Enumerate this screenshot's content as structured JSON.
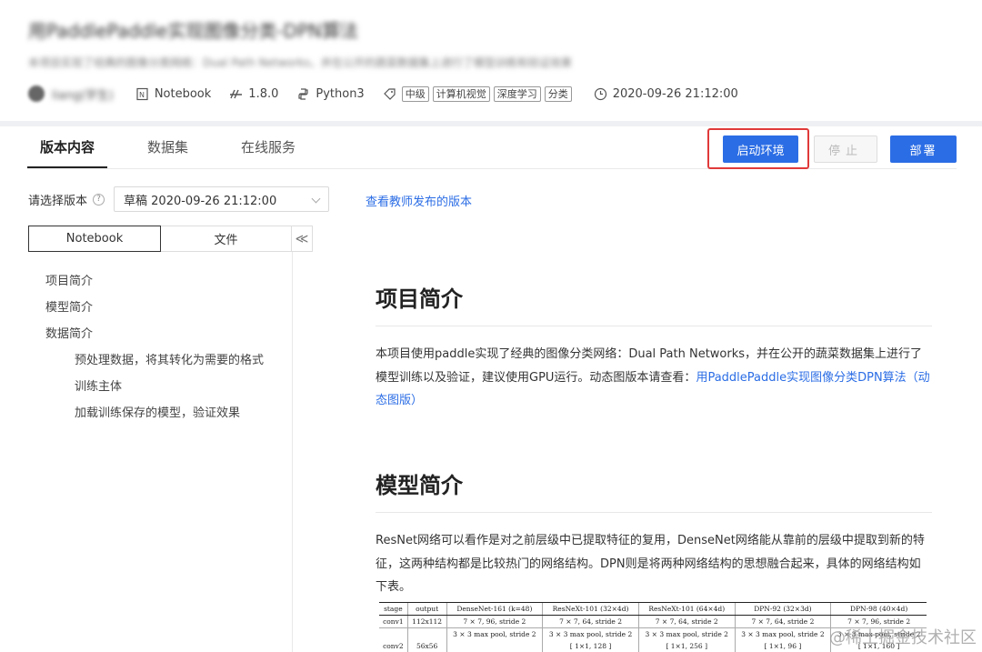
{
  "project": {
    "title": "用PaddlePaddle实现图像分类-DPN算法",
    "description": "本项目实现了经典的图像分类网络：Dual Path Networks，并在公开的蔬菜数据集上进行了模型训练和验证效果",
    "author": "liang(学生)",
    "notebook_label": "Notebook",
    "version": "1.8.0",
    "language": "Python3",
    "tags": [
      "中级",
      "计算机视觉",
      "深度学习",
      "分类"
    ],
    "datetime": "2020-09-26 21:12:00"
  },
  "tabs": [
    {
      "label": "版本内容",
      "active": true
    },
    {
      "label": "数据集",
      "active": false
    },
    {
      "label": "在线服务",
      "active": false
    }
  ],
  "actions": {
    "start_label": "启动环境",
    "stop_label": "停止",
    "deploy_label": "部署"
  },
  "version_select": {
    "label": "请选择版本",
    "help_glyph": "?",
    "value": "草稿 2020-09-26 21:12:00",
    "teacher_link": "查看教师发布的版本"
  },
  "left_panel": {
    "tab_notebook": "Notebook",
    "tab_files": "文件",
    "collapse_glyph": "≪",
    "toc": [
      {
        "label": "项目简介",
        "level": 1
      },
      {
        "label": "模型简介",
        "level": 1
      },
      {
        "label": "数据简介",
        "level": 1
      },
      {
        "label": "预处理数据，将其转化为需要的格式",
        "level": 2
      },
      {
        "label": "训练主体",
        "level": 2
      },
      {
        "label": "加载训练保存的模型，验证效果",
        "level": 2
      }
    ]
  },
  "notebook": {
    "section1_title": "项目简介",
    "section1_text": "本项目使用paddle实现了经典的图像分类网络：Dual Path Networks，并在公开的蔬菜数据集上进行了模型训练以及验证，建议使用GPU运行。动态图版本请查看：",
    "section1_link": "用PaddlePaddle实现图像分类DPN算法（动态图版）",
    "section2_title": "模型简介",
    "section2_text": "ResNet网络可以看作是对之前层级中已提取特征的复用，DenseNet网络能从靠前的层级中提取到新的特征，这两种结构都是比较热门的网络结构。DPN则是将两种网络结构的思想融合起来，具体的网络结构如下表。"
  },
  "table": {
    "headers": [
      "stage",
      "output",
      "DenseNet-161 (k=48)",
      "ResNeXt-101 (32×4d)",
      "ResNeXt-101 (64×4d)",
      "DPN-92 (32×3d)",
      "DPN-98 (40×4d)"
    ],
    "rows": [
      [
        "conv1",
        "112x112",
        "7 × 7, 96, stride 2",
        "7 × 7, 64, stride 2",
        "7 × 7, 64, stride 2",
        "7 × 7, 64, stride 2",
        "7 × 7, 96, stride 2"
      ],
      [
        "",
        "",
        "3 × 3 max pool, stride 2",
        "3 × 3 max pool, stride 2",
        "3 × 3 max pool, stride 2",
        "3 × 3 max pool, stride 2",
        "3 × 3 max pool, stride 2"
      ],
      [
        "conv2",
        "56x56",
        "",
        "[ 1×1, 128 ]",
        "[ 1×1, 256 ]",
        "[ 1×1, 96 ]",
        "[ 1×1, 160 ]"
      ]
    ]
  },
  "watermark": "@稀土掘金技术社区"
}
